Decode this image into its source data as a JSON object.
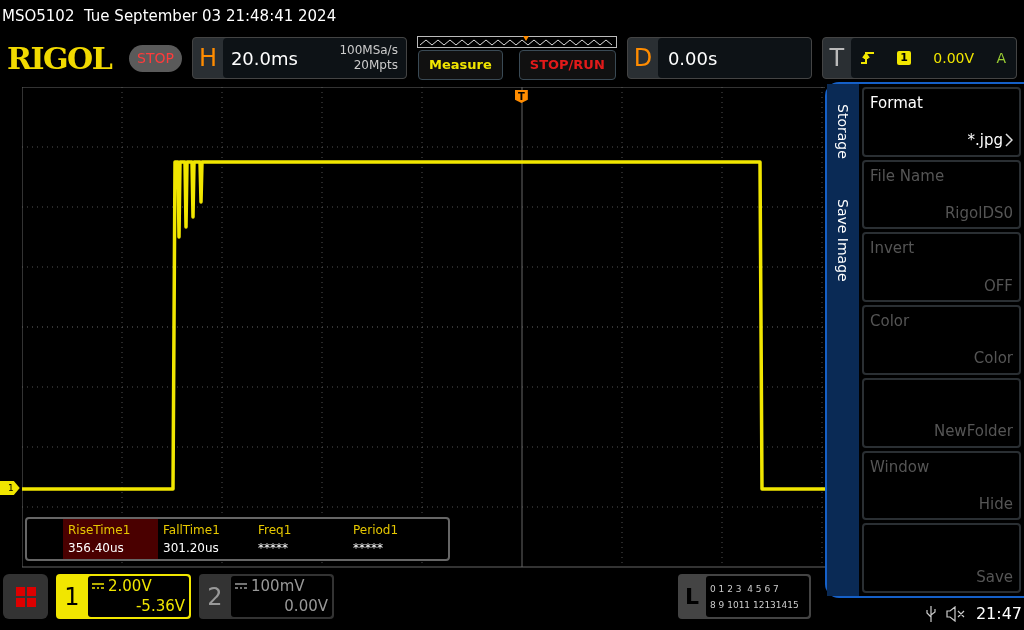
{
  "status_line": "MSO5102  Tue September 03 21:48:41 2024",
  "toolbar": {
    "logo": "RIGOL",
    "run_state": "STOP",
    "horizontal": {
      "letter": "H",
      "timebase": "20.0ms",
      "sample_rate": "100MSa/s",
      "memory_depth": "20Mpts"
    },
    "buttons": [
      "Measure",
      "STOP/RUN"
    ],
    "delay": {
      "letter": "D",
      "value": "0.00s"
    },
    "trigger": {
      "letter": "T",
      "source": "1",
      "level": "0.00V",
      "mode": "A"
    }
  },
  "scope": {
    "channel_marker": "1",
    "trigger_marker": "T"
  },
  "measurements": [
    {
      "label": "RiseTime1",
      "value": "356.40us",
      "selected": true
    },
    {
      "label": "FallTime1",
      "value": "301.20us",
      "selected": false
    },
    {
      "label": "Freq1",
      "value": "*****",
      "selected": false
    },
    {
      "label": "Period1",
      "value": "*****",
      "selected": false
    }
  ],
  "side_menu": {
    "tabs": [
      "Storage",
      "Save Image"
    ],
    "items": [
      {
        "label": "Format",
        "value": "*.jpg",
        "disabled": false,
        "submenu": true
      },
      {
        "label": "File Name",
        "value": "RigolDS0",
        "disabled": true,
        "submenu": false
      },
      {
        "label": "Invert",
        "value": "OFF",
        "disabled": true,
        "submenu": false
      },
      {
        "label": "Color",
        "value": "Color",
        "disabled": true,
        "submenu": false
      },
      {
        "value": "NewFolder",
        "disabled": true,
        "submenu": false
      },
      {
        "label": "Window",
        "value": "Hide",
        "disabled": true,
        "submenu": false
      },
      {
        "value": "Save",
        "disabled": true,
        "submenu": false
      }
    ]
  },
  "channels": [
    {
      "number": "1",
      "scale": "2.00V",
      "offset": "-5.36V",
      "active": true
    },
    {
      "number": "2",
      "scale": "100mV",
      "offset": "0.00V",
      "active": false
    }
  ],
  "logic": {
    "letter": "L",
    "rows": [
      "0 1 2 3  4 5 6 7",
      "8 9 1011 12131415"
    ]
  },
  "clock": "21:47"
}
